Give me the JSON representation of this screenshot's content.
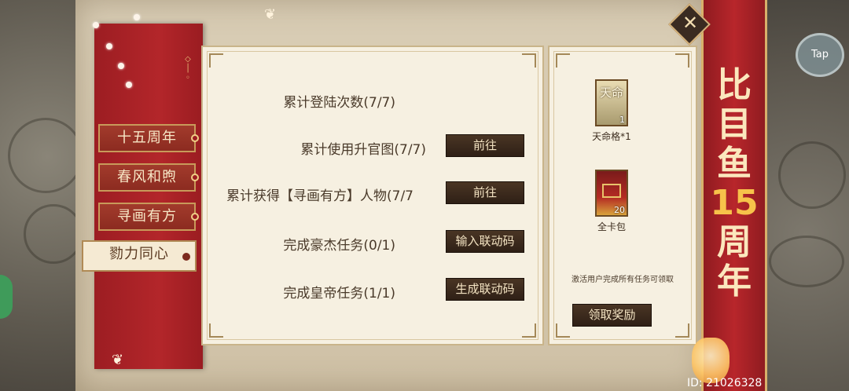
{
  "tabs": [
    {
      "label": "十五周年",
      "active": false
    },
    {
      "label": "春风和煦",
      "active": false
    },
    {
      "label": "寻画有方",
      "active": false
    },
    {
      "label": "勠力同心",
      "active": true
    }
  ],
  "tasks": [
    {
      "label": "累计登陆次数(7/7)",
      "button": ""
    },
    {
      "label": "累计使用升官图(7/7)",
      "button": "前往"
    },
    {
      "label": "累计获得【寻画有方】人物(7/7",
      "button": "前往"
    },
    {
      "label": "完成豪杰任务(0/1)",
      "button": "输入联动码"
    },
    {
      "label": "完成皇帝任务(1/1)",
      "button": "生成联动码"
    }
  ],
  "rewards": [
    {
      "card_text": "天命",
      "qty": "1",
      "name": "天命格*1"
    },
    {
      "qty": "20",
      "name": "全卡包"
    }
  ],
  "claim": {
    "note": "激活用户完成所有任务可领取",
    "button": "领取奖励"
  },
  "title": {
    "line1": "比",
    "line2": "目",
    "line3": "鱼",
    "number": "15",
    "line4": "周",
    "line5": "年"
  },
  "tap_label": "Tap",
  "user_id": "ID: 21026328",
  "colors": {
    "banner_red": "#b3262a",
    "gold": "#d8b06a",
    "panel_bg": "#f6f0e1",
    "button_dark": "#3a2a1c"
  }
}
